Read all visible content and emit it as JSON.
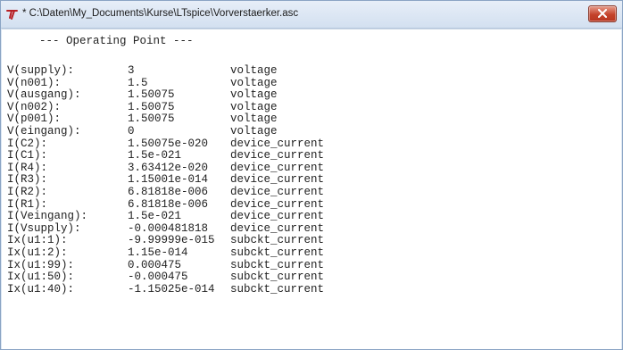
{
  "window": {
    "title": "* C:\\Daten\\My_Documents\\Kurse\\LTspice\\Vorverstaerker.asc",
    "app_icon": "ltspice-icon",
    "close_icon": "close-icon",
    "close_color": "#c4432b"
  },
  "report": {
    "heading": "--- Operating Point ---",
    "columns": [
      "name",
      "value",
      "type"
    ],
    "rows": [
      {
        "name": "V(supply):",
        "value": "3",
        "type": "voltage"
      },
      {
        "name": "V(n001):",
        "value": "1.5",
        "type": "voltage"
      },
      {
        "name": "V(ausgang):",
        "value": "1.50075",
        "type": "voltage"
      },
      {
        "name": "V(n002):",
        "value": "1.50075",
        "type": "voltage"
      },
      {
        "name": "V(p001):",
        "value": "1.50075",
        "type": "voltage"
      },
      {
        "name": "V(eingang):",
        "value": "0",
        "type": "voltage"
      },
      {
        "name": "I(C2):",
        "value": "1.50075e-020",
        "type": "device_current"
      },
      {
        "name": "I(C1):",
        "value": "1.5e-021",
        "type": "device_current"
      },
      {
        "name": "I(R4):",
        "value": "3.63412e-020",
        "type": "device_current"
      },
      {
        "name": "I(R3):",
        "value": "1.15001e-014",
        "type": "device_current"
      },
      {
        "name": "I(R2):",
        "value": "6.81818e-006",
        "type": "device_current"
      },
      {
        "name": "I(R1):",
        "value": "6.81818e-006",
        "type": "device_current"
      },
      {
        "name": "I(Veingang):",
        "value": "1.5e-021",
        "type": "device_current"
      },
      {
        "name": "I(Vsupply):",
        "value": "-0.000481818",
        "type": "device_current"
      },
      {
        "name": "Ix(u1:1):",
        "value": "-9.99999e-015",
        "type": "subckt_current"
      },
      {
        "name": "Ix(u1:2):",
        "value": "1.15e-014",
        "type": "subckt_current"
      },
      {
        "name": "Ix(u1:99):",
        "value": "0.000475",
        "type": "subckt_current"
      },
      {
        "name": "Ix(u1:50):",
        "value": "-0.000475",
        "type": "subckt_current"
      },
      {
        "name": "Ix(u1:40):",
        "value": "-1.15025e-014",
        "type": "subckt_current"
      }
    ]
  }
}
